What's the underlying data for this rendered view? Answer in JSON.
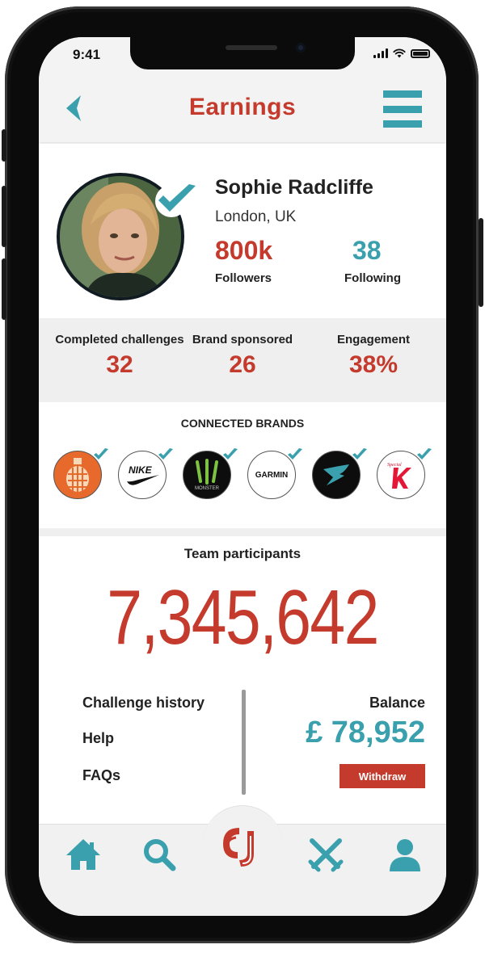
{
  "status_bar": {
    "time": "9:41"
  },
  "header": {
    "title": "Earnings"
  },
  "profile": {
    "name": "Sophie Radcliffe",
    "location": "London, UK",
    "followers_count": "800k",
    "followers_label": "Followers",
    "following_count": "38",
    "following_label": "Following"
  },
  "stats": [
    {
      "label": "Completed challenges",
      "value": "32"
    },
    {
      "label": "Brand sponsored",
      "value": "26"
    },
    {
      "label": "Engagement",
      "value": "38%"
    }
  ],
  "brands": {
    "title": "CONNECTED BRANDS",
    "items": [
      {
        "name": "grenade",
        "icon": "grenade-icon"
      },
      {
        "name": "NIKE",
        "icon": "nike-logo"
      },
      {
        "name": "MONSTER",
        "icon": "monster-energy-logo"
      },
      {
        "name": "GARMIN",
        "icon": "garmin-logo"
      },
      {
        "name": "gymshark",
        "icon": "gymshark-logo"
      },
      {
        "name": "Special K",
        "icon": "special-k-logo"
      }
    ]
  },
  "team": {
    "label": "Team participants",
    "count": "7,345,642"
  },
  "links": {
    "history": "Challenge history",
    "help": "Help",
    "faqs": "FAQs"
  },
  "balance": {
    "label": "Balance",
    "amount": "£ 78,952",
    "withdraw_label": "Withdraw"
  },
  "tabbar": {
    "items": [
      "home-icon",
      "search-icon",
      "app-logo-icon",
      "swords-icon",
      "profile-icon"
    ]
  },
  "colors": {
    "accent_red": "#c43b2d",
    "accent_teal": "#3aa0ad",
    "background": "#f3f3f3"
  }
}
